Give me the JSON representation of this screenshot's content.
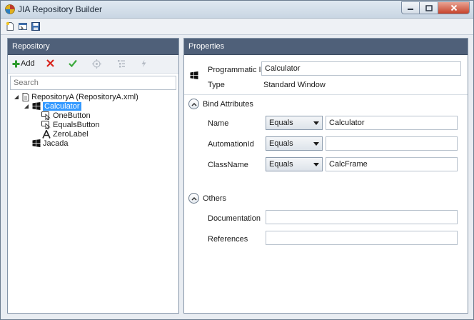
{
  "window": {
    "title": "JIA Repository Builder"
  },
  "repository_panel": {
    "header": "Repository",
    "toolbar": {
      "add_label": "Add"
    },
    "search": {
      "placeholder": "Search"
    },
    "tree": {
      "root": "RepositoryA (RepositoryA.xml)",
      "calculator": "Calculator",
      "one_button": "OneButton",
      "equals_button": "EqualsButton",
      "zero_label": "ZeroLabel",
      "jacada": "Jacada"
    }
  },
  "properties_panel": {
    "header": "Properties",
    "programmatic_id_label": "Programmatic Id",
    "programmatic_id_value": "Calculator",
    "type_label": "Type",
    "type_value": "Standard Window",
    "bind_attributes": {
      "title": "Bind Attributes",
      "rows": [
        {
          "label": "Name",
          "operator": "Equals",
          "value": "Calculator"
        },
        {
          "label": "AutomationId",
          "operator": "Equals",
          "value": ""
        },
        {
          "label": "ClassName",
          "operator": "Equals",
          "value": "CalcFrame"
        }
      ]
    },
    "others": {
      "title": "Others",
      "documentation_label": "Documentation",
      "documentation_value": "",
      "references_label": "References",
      "references_value": ""
    }
  },
  "colors": {
    "panel_header": "#4f6079",
    "selection": "#3399ff",
    "add_green": "#2e9b2e",
    "delete_red": "#d8231b"
  }
}
